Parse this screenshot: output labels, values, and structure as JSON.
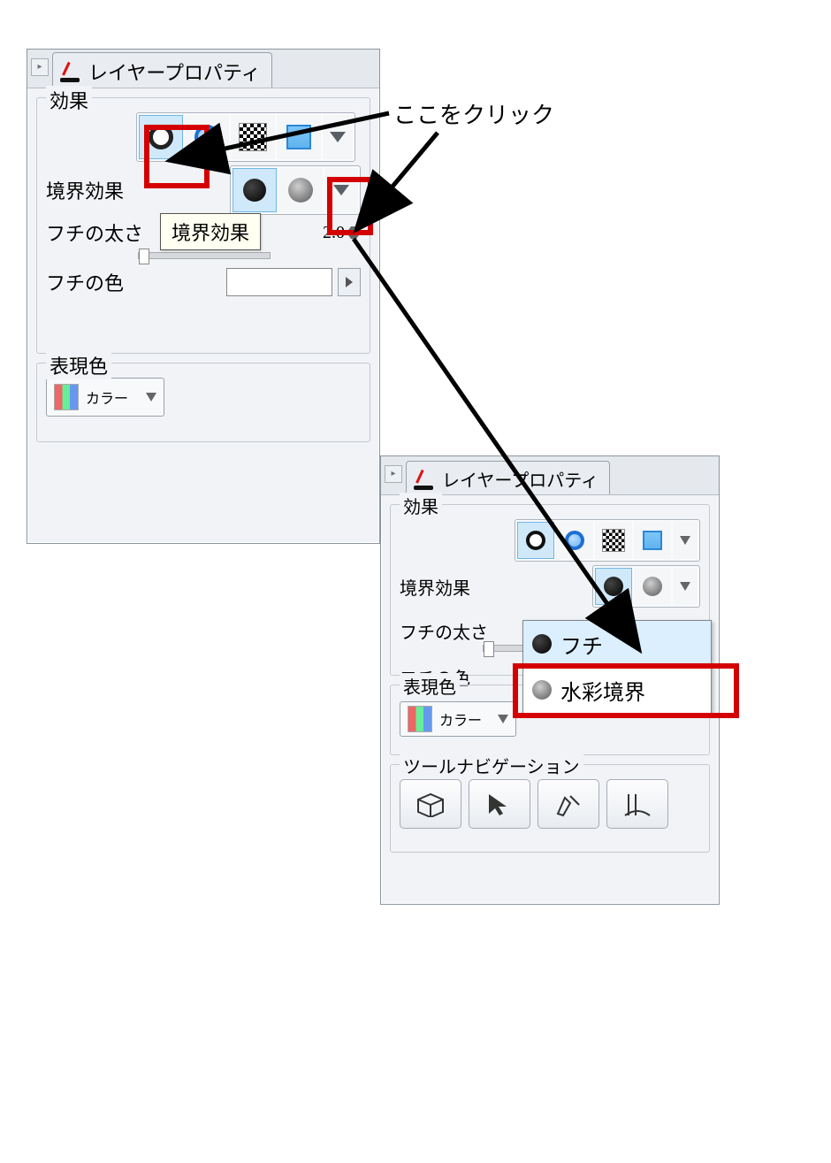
{
  "annotation": {
    "click_here": "ここをクリック"
  },
  "panel1": {
    "tab_title": "レイヤープロパティ",
    "group_effect": "効果",
    "label_border_effect": "境界効果",
    "tooltip_border_effect": "境界効果",
    "label_edge_thickness": "フチの太さ",
    "edge_thickness_value": "2.0",
    "label_edge_color": "フチの色",
    "group_expression_color": "表現色",
    "dropdown_color": "カラー"
  },
  "panel2": {
    "tab_title": "レイヤープロパティ",
    "group_effect": "効果",
    "label_border_effect": "境界効果",
    "label_edge_thickness": "フチの太さ",
    "label_edge_color": "フチの色",
    "menu_item_edge": "フチ",
    "menu_item_watercolor": "水彩境界",
    "group_expression_color": "表現色",
    "dropdown_color": "カラー",
    "group_tool_nav": "ツールナビゲーション"
  }
}
